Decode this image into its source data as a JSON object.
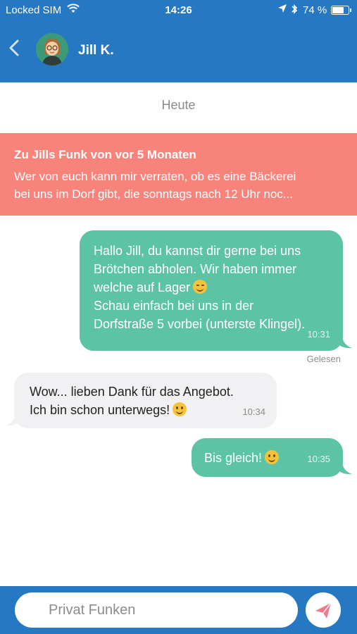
{
  "status_bar": {
    "carrier": "Locked SIM",
    "time": "14:26",
    "battery_percent": "74 %",
    "battery_level": 0.74,
    "icons": [
      "wifi-icon",
      "location-icon",
      "bluetooth-icon",
      "battery-icon"
    ]
  },
  "header": {
    "contact_name": "Jill K.",
    "back_icon": "chevron-left-icon",
    "avatar_icon": "avatar-jill"
  },
  "chat": {
    "date_label": "Heute",
    "quote": {
      "title": "Zu Jills Funk von vor 5 Monaten",
      "text_line1": "Wer von euch kann mir verraten, ob es eine Bäckerei",
      "text_line2": "bei uns im Dorf gibt, die sonntags nach 12 Uhr noc..."
    },
    "messages": [
      {
        "direction": "outgoing",
        "lines": [
          "Hallo Jill, du kannst dir gerne bei uns",
          "Brötchen abholen. Wir haben immer",
          "welche auf Lager",
          "Schau einfach bei uns in der",
          "Dorfstraße 5 vorbei (unterste Klingel)."
        ],
        "emoji": "winking-face",
        "time": "10:31",
        "status": "Gelesen"
      },
      {
        "direction": "incoming",
        "lines": [
          "Wow... lieben Dank für das Angebot.",
          "Ich bin schon unterwegs!"
        ],
        "emoji": "smiling-face",
        "time": "10:34"
      },
      {
        "direction": "outgoing",
        "lines": [
          "Bis gleich!"
        ],
        "emoji": "smiling-face",
        "time": "10:35"
      }
    ]
  },
  "composer": {
    "placeholder": "Privat Funken",
    "send_icon": "paper-plane-icon"
  },
  "colors": {
    "primary_blue": "#2678c2",
    "outgoing_bubble": "#5dc3a5",
    "incoming_bubble": "#f1f1f4",
    "quote_banner": "#f8837a",
    "send_icon": "#f07a8a"
  }
}
